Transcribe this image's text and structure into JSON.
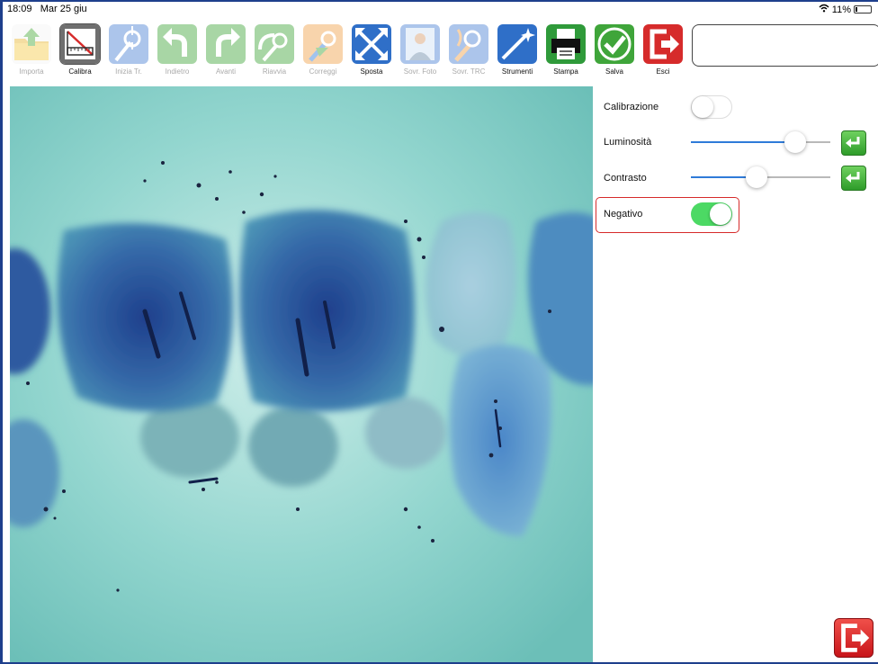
{
  "status_bar": {
    "time": "18:09",
    "date": "Mar 25 giu",
    "battery": "11%",
    "icons": [
      "wifi-icon",
      "battery-icon"
    ]
  },
  "toolbar": {
    "items": [
      {
        "label": "Importa",
        "icon": "folder-import-icon",
        "enabled": false
      },
      {
        "label": "Calibra",
        "icon": "ruler-calibrate-icon",
        "enabled": true
      },
      {
        "label": "Inizia Tr.",
        "icon": "start-trace-icon",
        "enabled": false
      },
      {
        "label": "Indietro",
        "icon": "undo-arrow-icon",
        "enabled": false
      },
      {
        "label": "Avanti",
        "icon": "redo-arrow-icon",
        "enabled": false
      },
      {
        "label": "Riavvia",
        "icon": "restart-trace-icon",
        "enabled": false
      },
      {
        "label": "Correggi",
        "icon": "correct-trace-icon",
        "enabled": false
      },
      {
        "label": "Sposta",
        "icon": "move-arrows-icon",
        "enabled": true
      },
      {
        "label": "Sovr. Foto",
        "icon": "overlay-photo-icon",
        "enabled": false
      },
      {
        "label": "Sovr. TRC",
        "icon": "overlay-trace-icon",
        "enabled": false
      },
      {
        "label": "Strumenti",
        "icon": "magic-wand-icon",
        "enabled": true
      },
      {
        "label": "Stampa",
        "icon": "printer-icon",
        "enabled": true
      },
      {
        "label": "Salva",
        "icon": "checkmark-save-icon",
        "enabled": true
      },
      {
        "label": "Esci",
        "icon": "exit-icon",
        "enabled": true
      }
    ]
  },
  "panel": {
    "calibrazione": {
      "label": "Calibrazione",
      "on": false
    },
    "luminosita": {
      "label": "Luminosità",
      "value": 0.75
    },
    "contrasto": {
      "label": "Contrasto",
      "value": 0.47
    },
    "negativo": {
      "label": "Negativo",
      "on": true
    }
  },
  "colors": {
    "accent_blue": "#2f7bd8",
    "toggle_on": "#4cd964",
    "highlight_red": "#d62b2b",
    "frame": "#1e3f8c"
  }
}
